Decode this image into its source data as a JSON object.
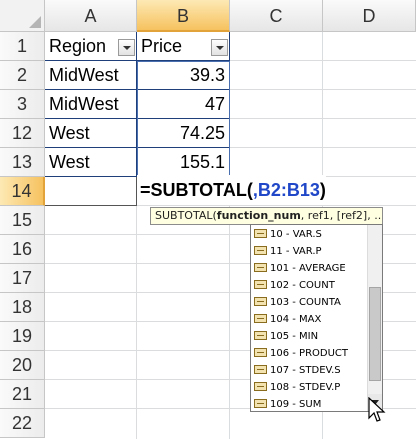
{
  "columns": [
    "A",
    "B",
    "C",
    "D"
  ],
  "rows": [
    "1",
    "2",
    "3",
    "12",
    "13",
    "14",
    "15",
    "16",
    "17",
    "18",
    "19",
    "20",
    "21",
    "22"
  ],
  "table": {
    "headers": [
      "Region",
      "Price"
    ],
    "rows": [
      {
        "region": "MidWest",
        "price": "39.3"
      },
      {
        "region": "MidWest",
        "price": "47"
      },
      {
        "region": "West",
        "price": "74.25"
      },
      {
        "region": "West",
        "price": "155.1"
      }
    ]
  },
  "formula": {
    "prefix": "=SUBTOTAL(",
    "ref": ",B2:B13",
    "suffix": ")"
  },
  "tooltip": {
    "func": "SUBTOTAL(",
    "arg_bold": "function_num",
    "rest": ", ref1, [ref2], ...)"
  },
  "dropdown_items": [
    "10 - VAR.S",
    "11 - VAR.P",
    "101 - AVERAGE",
    "102 - COUNT",
    "103 - COUNTA",
    "104 - MAX",
    "105 - MIN",
    "106 - PRODUCT",
    "107 - STDEV.S",
    "108 - STDEV.P",
    "109 - SUM"
  ],
  "selected": {
    "column": "B",
    "row": "14"
  },
  "colors": {
    "accent": "#f6c25f",
    "table_border": "#1f3f7a",
    "ref": "#1f47c8"
  }
}
